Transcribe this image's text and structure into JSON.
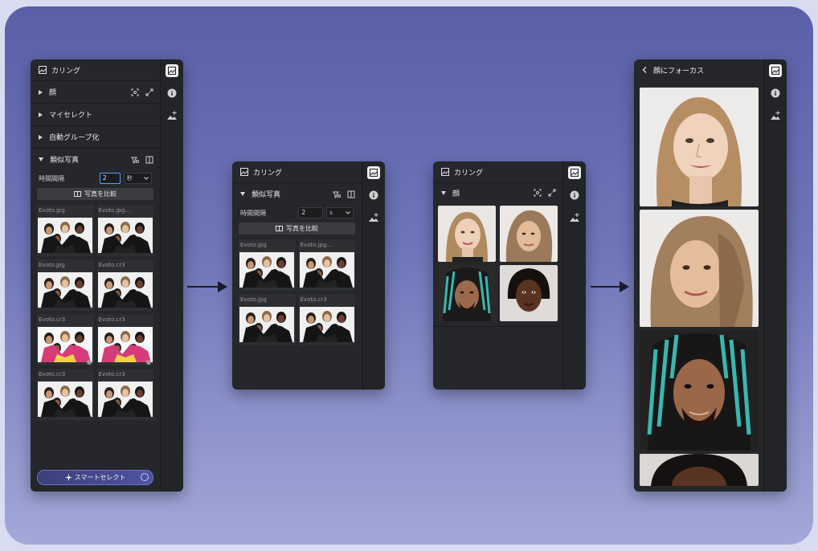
{
  "panel1": {
    "title": "カリング",
    "sections": [
      "顔",
      "マイセレクト",
      "自動グループ化",
      "類似写真"
    ],
    "time_label": "時間間隔",
    "time_value": "2",
    "unit": "秒",
    "compare": "写真を比較",
    "files": [
      "Evoto.jpg",
      "Evoto.jpg...",
      "Evoto.jpg",
      "Evoto.cr3",
      "Evoto.cr3",
      "Evoto.cr3",
      "Evoto.cr3",
      "Evoto.cr3"
    ],
    "smart_select": "スマートセレクト"
  },
  "panel2": {
    "title": "カリング",
    "section": "類似写真",
    "time_label": "時間間隔",
    "time_value": "2",
    "unit": "s",
    "compare": "写真を比較",
    "files": [
      "Evoto.jpg",
      "Evoto.jpg...",
      "Evoto.jpg",
      "Evoto.cr3"
    ]
  },
  "panel3": {
    "title": "カリング",
    "section": "顔"
  },
  "panel4": {
    "title": "顔にフォーカス"
  },
  "colors": {
    "panel": "#25272b",
    "accent": "#5c9df5",
    "smart": "#4e54a0"
  }
}
